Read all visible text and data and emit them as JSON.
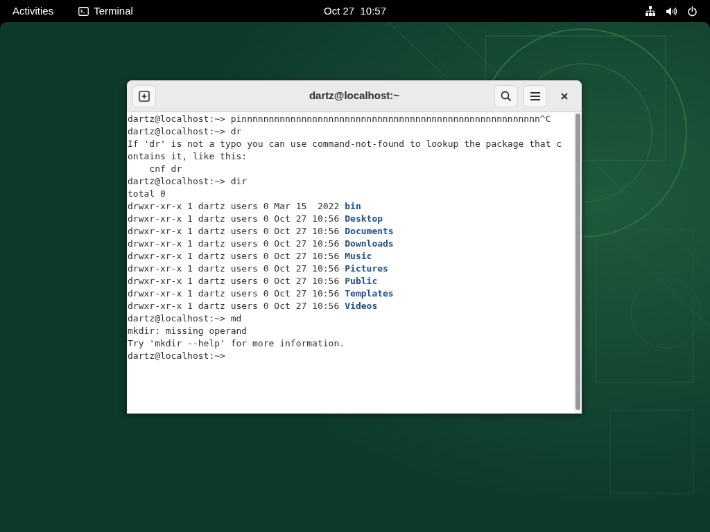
{
  "top_bar": {
    "activities": "Activities",
    "app_name": "Terminal",
    "clock": "Oct 27  10:57"
  },
  "window": {
    "title": "dartz@localhost:~"
  },
  "terminal_lines": [
    {
      "kind": "text",
      "text": "dartz@localhost:~> pinnnnnnnnnnnnnnnnnnnnnnnnnnnnnnnnnnnnnnnnnnnnnnnnnnnnnnn^C"
    },
    {
      "kind": "text",
      "text": "dartz@localhost:~> dr"
    },
    {
      "kind": "text",
      "text": "If 'dr' is not a typo you can use command-not-found to lookup the package that c"
    },
    {
      "kind": "text",
      "text": "ontains it, like this:"
    },
    {
      "kind": "text",
      "text": "    cnf dr"
    },
    {
      "kind": "text",
      "text": "dartz@localhost:~> dir"
    },
    {
      "kind": "text",
      "text": "total 0"
    },
    {
      "kind": "listing",
      "text": "drwxr-xr-x 1 dartz users 0 Mar 15  2022",
      "dir": "bin"
    },
    {
      "kind": "listing",
      "text": "drwxr-xr-x 1 dartz users 0 Oct 27 10:56",
      "dir": "Desktop"
    },
    {
      "kind": "listing",
      "text": "drwxr-xr-x 1 dartz users 0 Oct 27 10:56",
      "dir": "Documents"
    },
    {
      "kind": "listing",
      "text": "drwxr-xr-x 1 dartz users 0 Oct 27 10:56",
      "dir": "Downloads"
    },
    {
      "kind": "listing",
      "text": "drwxr-xr-x 1 dartz users 0 Oct 27 10:56",
      "dir": "Music"
    },
    {
      "kind": "listing",
      "text": "drwxr-xr-x 1 dartz users 0 Oct 27 10:56",
      "dir": "Pictures"
    },
    {
      "kind": "listing",
      "text": "drwxr-xr-x 1 dartz users 0 Oct 27 10:56",
      "dir": "Public"
    },
    {
      "kind": "listing",
      "text": "drwxr-xr-x 1 dartz users 0 Oct 27 10:56",
      "dir": "Templates"
    },
    {
      "kind": "listing",
      "text": "drwxr-xr-x 1 dartz users 0 Oct 27 10:56",
      "dir": "Videos"
    },
    {
      "kind": "text",
      "text": "dartz@localhost:~> md"
    },
    {
      "kind": "text",
      "text": "mkdir: missing operand"
    },
    {
      "kind": "text",
      "text": "Try 'mkdir --help' for more information."
    },
    {
      "kind": "text",
      "text": "dartz@localhost:~>"
    }
  ]
}
